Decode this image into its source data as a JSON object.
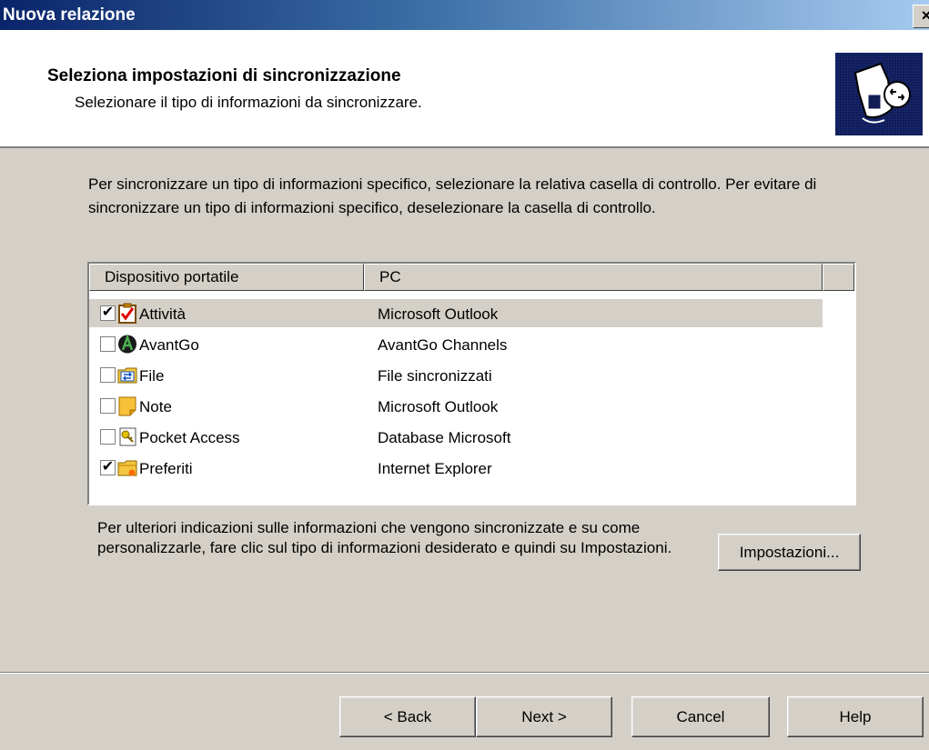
{
  "window": {
    "title": "Nuova relazione",
    "close_label": "×"
  },
  "header": {
    "title": "Seleziona impostazioni di sincronizzazione",
    "subtitle": "Selezionare il tipo di informazioni da sincronizzare.",
    "icon": "sync-handheld-icon"
  },
  "intro_text": "Per sincronizzare un tipo di informazioni specifico, selezionare la relativa casella di controllo. Per evitare di sincronizzare un tipo di informazioni specifico, deselezionare la casella di controllo.",
  "list": {
    "columns": [
      "Dispositivo portatile",
      "PC"
    ],
    "items": [
      {
        "label": "Attività",
        "pc": "Microsoft Outlook",
        "checked": true,
        "selected": true,
        "icon": "tasks-icon"
      },
      {
        "label": "AvantGo",
        "pc": "AvantGo Channels",
        "checked": false,
        "selected": false,
        "icon": "avantgo-icon"
      },
      {
        "label": "File",
        "pc": "File sincronizzati",
        "checked": false,
        "selected": false,
        "icon": "file-sync-icon"
      },
      {
        "label": "Note",
        "pc": "Microsoft Outlook",
        "checked": false,
        "selected": false,
        "icon": "notes-icon"
      },
      {
        "label": "Pocket Access",
        "pc": "Database Microsoft",
        "checked": false,
        "selected": false,
        "icon": "pocket-access-icon"
      },
      {
        "label": "Preferiti",
        "pc": "Internet Explorer",
        "checked": true,
        "selected": false,
        "icon": "favorites-folder-icon"
      }
    ]
  },
  "footer_text": "Per ulteriori indicazioni sulle informazioni che vengono sincronizzate e su come personalizzarle, fare clic sul tipo di informazioni desiderato e quindi su Impostazioni.",
  "buttons": {
    "settings": "Impostazioni...",
    "back": "< Back",
    "next": "Next >",
    "cancel": "Cancel",
    "help": "Help"
  },
  "check_mark": "✔"
}
